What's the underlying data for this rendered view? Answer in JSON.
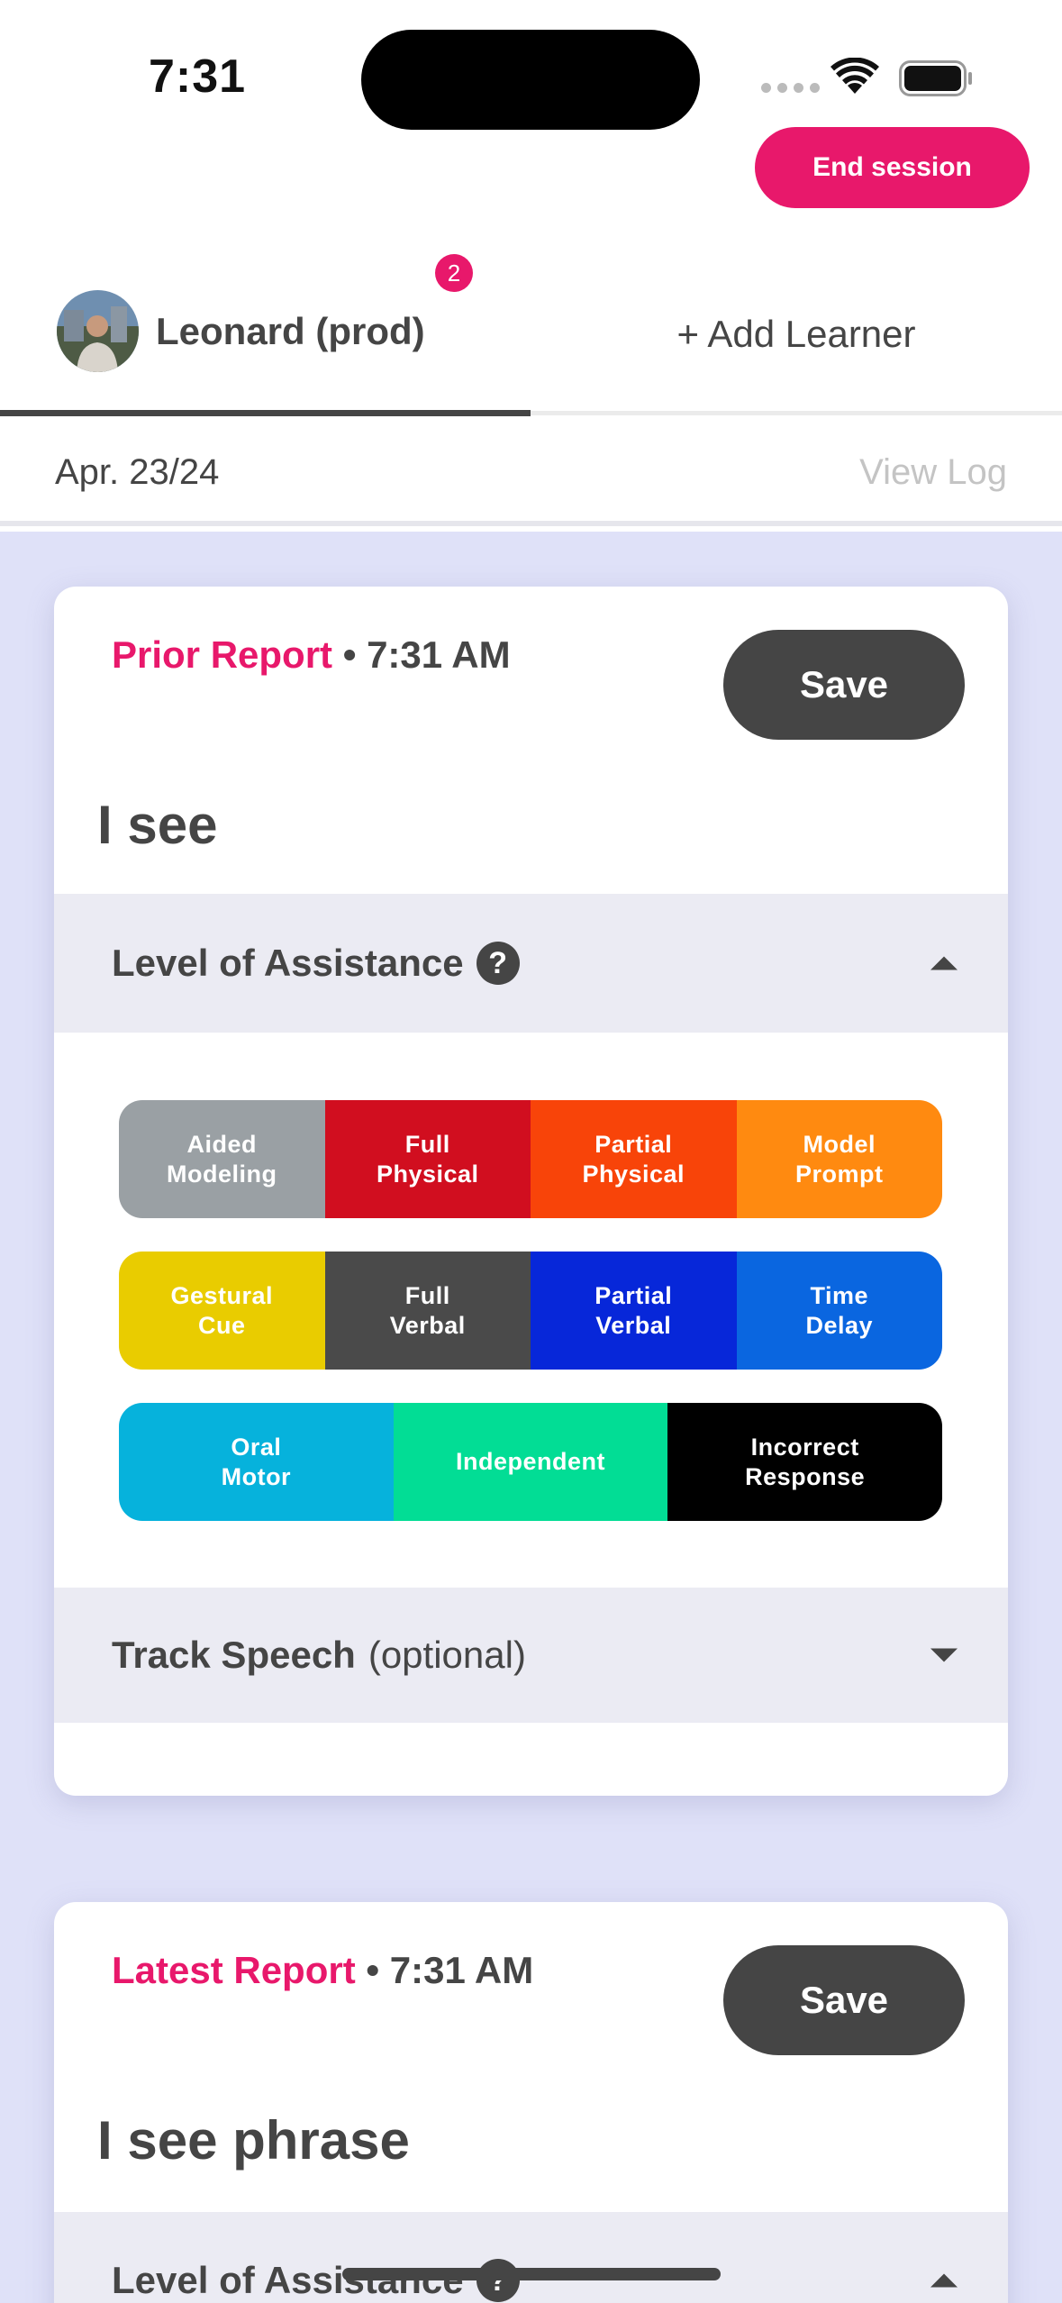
{
  "status_bar": {
    "time": "7:31"
  },
  "header": {
    "end_session_label": "End session"
  },
  "learner_tabs": {
    "active_learner": "Leonard (prod)",
    "notification_count": "2",
    "add_learner_label": "+ Add Learner"
  },
  "date_row": {
    "date": "Apr. 23/24",
    "view_log_label": "View Log"
  },
  "reports": [
    {
      "label": "Prior Report",
      "time": "• 7:31 AM",
      "save_label": "Save",
      "phrase": "I see",
      "assistance_title": "Level of Assistance",
      "track_speech_title": "Track Speech",
      "track_speech_optional": "(optional)"
    },
    {
      "label": "Latest Report",
      "time": "• 7:31 AM",
      "save_label": "Save",
      "phrase": "I see phrase",
      "assistance_title": "Level of Assistance"
    }
  ],
  "help_glyph": "?",
  "prompt_levels": [
    [
      {
        "label": "Aided\nModeling",
        "color": "#9aa0a4"
      },
      {
        "label": "Full\nPhysical",
        "color": "#d10e1f"
      },
      {
        "label": "Partial\nPhysical",
        "color": "#f84409"
      },
      {
        "label": "Model\nPrompt",
        "color": "#ff8a10"
      }
    ],
    [
      {
        "label": "Gestural\nCue",
        "color": "#e9cc00"
      },
      {
        "label": "Full\nVerbal",
        "color": "#4a4a4a"
      },
      {
        "label": "Partial\nVerbal",
        "color": "#0727d9"
      },
      {
        "label": "Time\nDelay",
        "color": "#0a66e0"
      }
    ],
    [
      {
        "label": "Oral\nMotor",
        "color": "#06b2dc"
      },
      {
        "label": "Independent",
        "color": "#02dd95"
      },
      {
        "label": "Incorrect\nResponse",
        "color": "#000000"
      }
    ]
  ],
  "icons": [
    "wifi-icon",
    "battery-icon",
    "cellular-signal-icon",
    "help-icon",
    "chevron-up-icon",
    "chevron-down-icon"
  ]
}
